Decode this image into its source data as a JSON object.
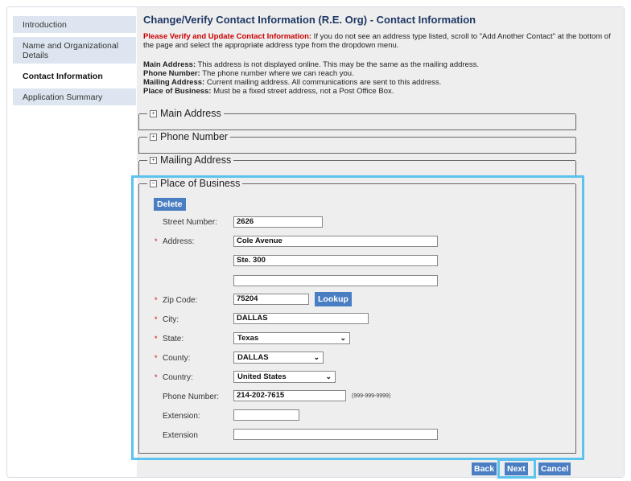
{
  "sidebar": {
    "items": [
      {
        "label": "Introduction"
      },
      {
        "label": "Name and Organizational Details"
      },
      {
        "label": "Contact Information"
      },
      {
        "label": "Application Summary"
      }
    ]
  },
  "header": {
    "title": "Change/Verify Contact Information (R.E. Org) - Contact Information",
    "instruction_bold": "Please Verify and Update Contact Information:",
    "instruction_rest": " If you do not see an address type listed, scroll to \"Add Another Contact\" at the bottom of the page and select the appropriate address type from the dropdown menu."
  },
  "definitions": [
    {
      "term": "Main Address:",
      "text": " This address is not displayed online. This may be the same as the mailing address."
    },
    {
      "term": "Phone Number:",
      "text": " The phone number where we can reach you."
    },
    {
      "term": "Mailing Address:",
      "text": " Current mailing address. All communications are sent to this address."
    },
    {
      "term": "Place of Business:",
      "text": " Must be a fixed street address, not a Post Office Box."
    }
  ],
  "sections": {
    "main_address": {
      "label": "Main Address",
      "toggle": "+"
    },
    "phone_number": {
      "label": "Phone Number",
      "toggle": "+"
    },
    "mailing_address": {
      "label": "Mailing Address",
      "toggle": "+"
    },
    "place_of_business": {
      "label": "Place of Business",
      "toggle": "−"
    }
  },
  "form": {
    "delete_label": "Delete",
    "street_number": {
      "label": "Street Number:",
      "value": "2626"
    },
    "address": {
      "label": "Address:",
      "line1": "Cole Avenue",
      "line2": "Ste. 300",
      "line3": ""
    },
    "zip": {
      "label": "Zip Code:",
      "value": "75204",
      "lookup_label": "Lookup"
    },
    "city": {
      "label": "City:",
      "value": "DALLAS"
    },
    "state": {
      "label": "State:",
      "value": "Texas"
    },
    "county": {
      "label": "County:",
      "value": "DALLAS"
    },
    "country": {
      "label": "Country:",
      "value": "United States"
    },
    "phone": {
      "label": "Phone Number:",
      "value": "214-202-7615",
      "hint": "(999-999-9999)"
    },
    "extension1": {
      "label": "Extension:",
      "value": ""
    },
    "extension2": {
      "label": "Extension",
      "value": ""
    },
    "required_mark": "*"
  },
  "nav": {
    "back": "Back",
    "next": "Next",
    "cancel": "Cancel"
  },
  "colors": {
    "accent": "#4a7ec2",
    "highlight": "#5bc3ef",
    "required": "#cc0000",
    "title": "#1f3864"
  }
}
